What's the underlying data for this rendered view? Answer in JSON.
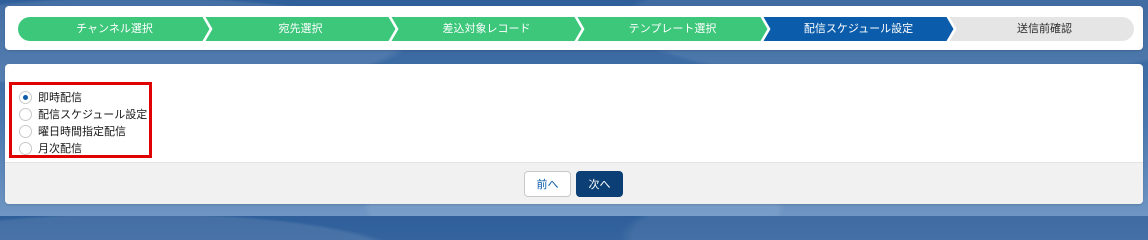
{
  "path": {
    "steps": [
      {
        "label": "チャンネル選択",
        "status": "complete"
      },
      {
        "label": "宛先選択",
        "status": "complete"
      },
      {
        "label": "差込対象レコード",
        "status": "complete"
      },
      {
        "label": "テンプレート選択",
        "status": "complete"
      },
      {
        "label": "配信スケジュール設定",
        "status": "current"
      },
      {
        "label": "送信前確認",
        "status": "incomplete"
      }
    ],
    "colors": {
      "complete": "#3cc77b",
      "current": "#0b5cab",
      "incomplete": "#e5e5e5"
    }
  },
  "delivery_options": {
    "selected": "即時配信",
    "items": [
      {
        "label": "即時配信",
        "checked": true
      },
      {
        "label": "配信スケジュール設定",
        "checked": false
      },
      {
        "label": "曜日時間指定配信",
        "checked": false
      },
      {
        "label": "月次配信",
        "checked": false
      }
    ],
    "highlight_color": "#e00000"
  },
  "footer": {
    "prev_label": "前へ",
    "next_label": "次へ"
  }
}
